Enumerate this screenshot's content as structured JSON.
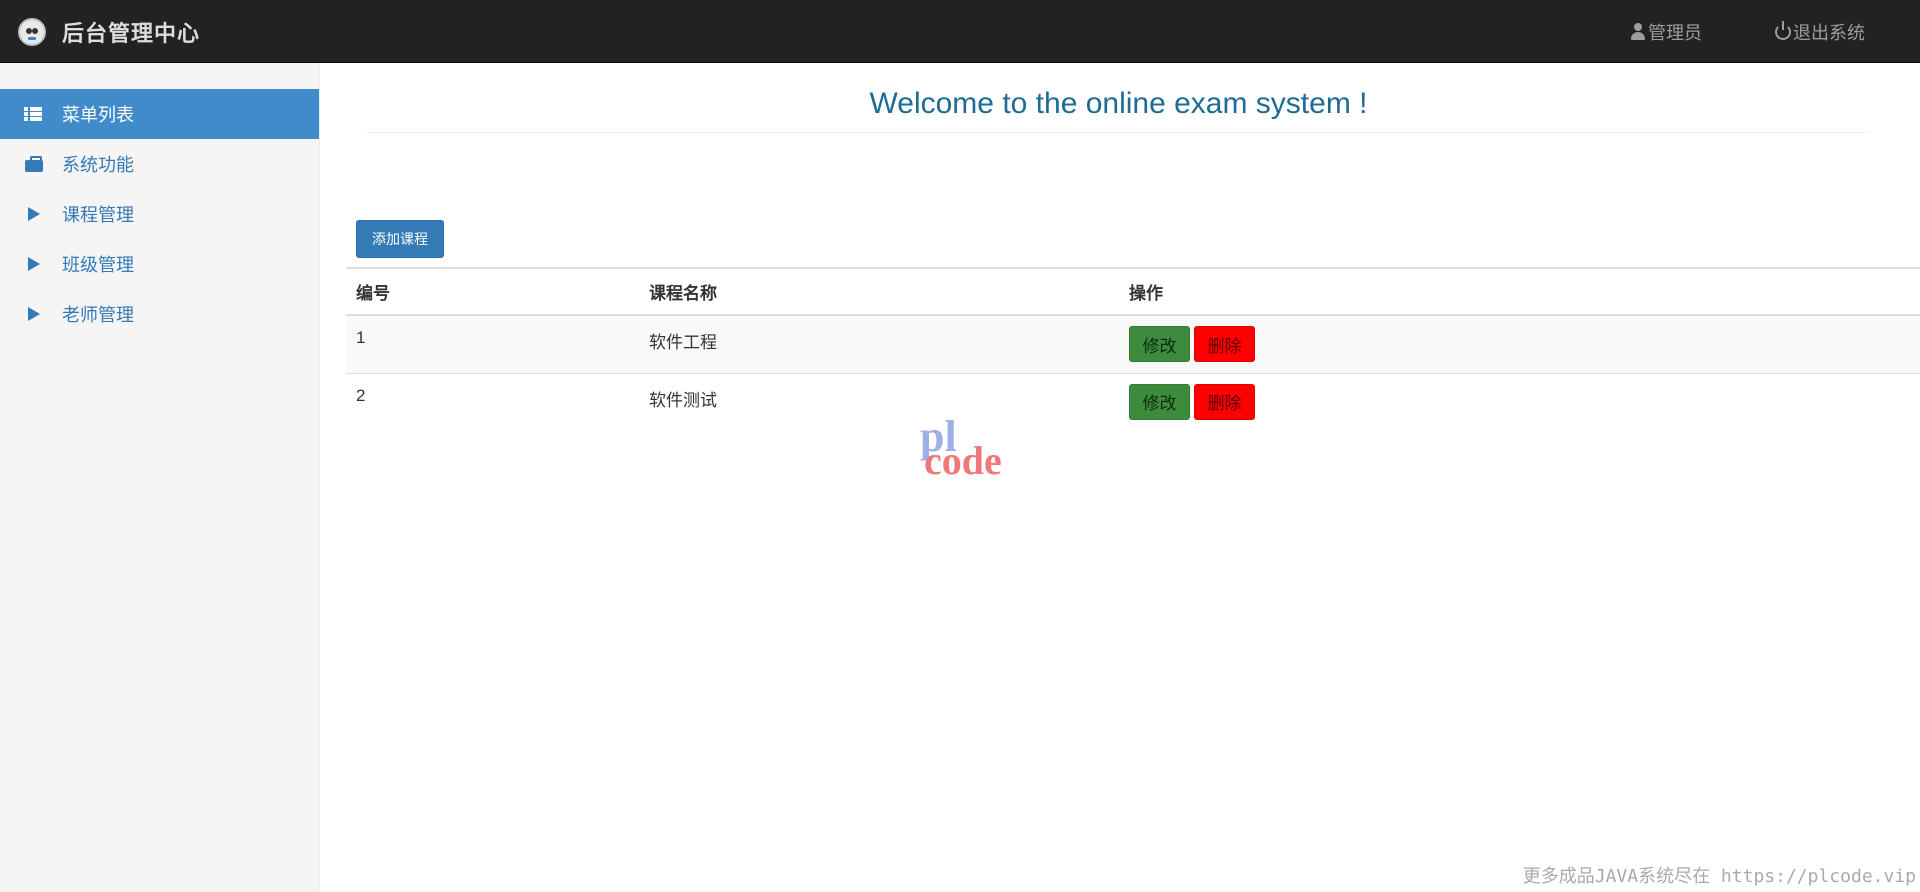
{
  "header": {
    "title": "后台管理中心",
    "admin_label": "管理员",
    "logout_label": "退出系统"
  },
  "sidebar": {
    "items": [
      {
        "label": "菜单列表",
        "icon": "list-icon",
        "active": true
      },
      {
        "label": "系统功能",
        "icon": "briefcase-icon",
        "active": false
      },
      {
        "label": "课程管理",
        "icon": "play-icon",
        "active": false
      },
      {
        "label": "班级管理",
        "icon": "play-icon",
        "active": false
      },
      {
        "label": "老师管理",
        "icon": "play-icon",
        "active": false
      }
    ]
  },
  "main": {
    "welcome": "Welcome to the online exam system !",
    "add_button": "添加课程",
    "table": {
      "headers": [
        "编号",
        "课程名称",
        "操作"
      ],
      "rows": [
        {
          "id": "1",
          "name": "软件工程",
          "edit": "修改",
          "delete": "删除"
        },
        {
          "id": "2",
          "name": "软件测试",
          "edit": "修改",
          "delete": "删除"
        }
      ]
    }
  },
  "watermark": {
    "logo_top": "pl",
    "logo_bottom": "code",
    "footer": "更多成品JAVA系统尽在 https://plcode.vip"
  },
  "colors": {
    "navbar": "#222222",
    "primary": "#337ab7",
    "active_menu": "#428bca",
    "success": "#3d8b3d",
    "danger": "#ff0000",
    "welcome_text": "#1f6b94"
  }
}
